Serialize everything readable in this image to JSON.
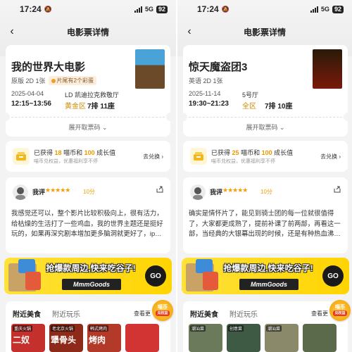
{
  "colors": {
    "accent": "#f2a000",
    "hall_color": "#d08a00",
    "banner": "#ffd400"
  },
  "panels": [
    {
      "status": {
        "time": "17:24",
        "network": "5G",
        "battery": "92"
      },
      "nav": {
        "title": "电影票详情",
        "back_icon": "chevron-left-icon"
      },
      "ticket": {
        "movie_title": "我的世界大电影",
        "format": "原版 2D 1张",
        "tag": "片尾有2个彩蛋",
        "date": "2025-04-04",
        "cinema": "LD 凯迪拉克救敬厅",
        "showtime": "12:15~13:56",
        "hall": "黄金区",
        "seat": "7排 11座",
        "expand_label": "展开取票码"
      },
      "points": {
        "line_prefix": "已获得",
        "coins": "18",
        "coins_unit": "喵币和",
        "value": "100",
        "value_unit": "成长值",
        "note": "喵币兑权益，优惠福利享不停",
        "exchange_label": "去兑换"
      },
      "review": {
        "label": "我评",
        "stars": "★★★★★",
        "score": "10分",
        "text": "我感觉还可以，整个影片比较积极向上，很有活力，给枯燥的生活打了一些鸡血，我的世界主题还是挺好玩的，如果再深究剧本增加更多脑洞就更好了，ip…"
      },
      "banner": {
        "headline": "抢爆款周边,快来吃谷子!",
        "brand": "MmmGoods",
        "cta": "GO"
      },
      "nearby": {
        "tab_food": "附近美食",
        "tab_fun": "附近玩乐",
        "see_all": "查看更",
        "coin_badge": "喵币",
        "coin_sub": "兑权益",
        "shops": [
          {
            "tag": "重庆火锅",
            "name": "二奴",
            "color": "#c4302b"
          },
          {
            "tag": "老北京火锅",
            "name": "犟骨头",
            "color": "#8e2a1a"
          },
          {
            "tag": "韩式烤肉",
            "name": "烤肉",
            "color": "#b33a28"
          },
          {
            "tag": "",
            "name": "",
            "color": "#d23434"
          }
        ]
      }
    },
    {
      "status": {
        "time": "17:24",
        "network": "5G",
        "battery": "92"
      },
      "nav": {
        "title": "电影票详情",
        "back_icon": "chevron-left-icon"
      },
      "ticket": {
        "movie_title": "惊天魔盗团3",
        "format": "英语 2D 1张",
        "tag": "",
        "date": "2025-11-14",
        "cinema": "5号厅",
        "showtime": "19:30~21:23",
        "hall": "全区",
        "seat": "7排 10座",
        "expand_label": "展开取票码"
      },
      "points": {
        "line_prefix": "已获得",
        "coins": "25",
        "coins_unit": "喵币和",
        "value": "100",
        "value_unit": "成长值",
        "note": "喵币兑权益，优惠福利享不停",
        "exchange_label": "去兑换"
      },
      "review": {
        "label": "我评",
        "stars": "★★★★★",
        "score": "10分",
        "text": "确实是情怀片了，能见到骑士团的每一位就很值得了，大家都更成熟了，提前补课了前两部，再看这一部，当经典的大银幕出现的时候，还是有种热血沸…"
      },
      "banner": {
        "headline": "抢爆款周边,快来吃谷子!",
        "brand": "MmmGoods",
        "cta": "GO"
      },
      "nearby": {
        "tab_food": "附近美食",
        "tab_fun": "附近玩乐",
        "see_all": "查看更",
        "coin_badge": "喵币",
        "coin_sub": "兑权益",
        "shops": [
          {
            "tag": "潮汕菜",
            "name": "",
            "color": "#6a7a5a"
          },
          {
            "tag": "创意菜",
            "name": "",
            "color": "#3e5a44"
          },
          {
            "tag": "潮汕菜",
            "name": "",
            "color": "#8a8a6a"
          },
          {
            "tag": "",
            "name": "",
            "color": "#5a6a4a"
          }
        ]
      }
    }
  ]
}
